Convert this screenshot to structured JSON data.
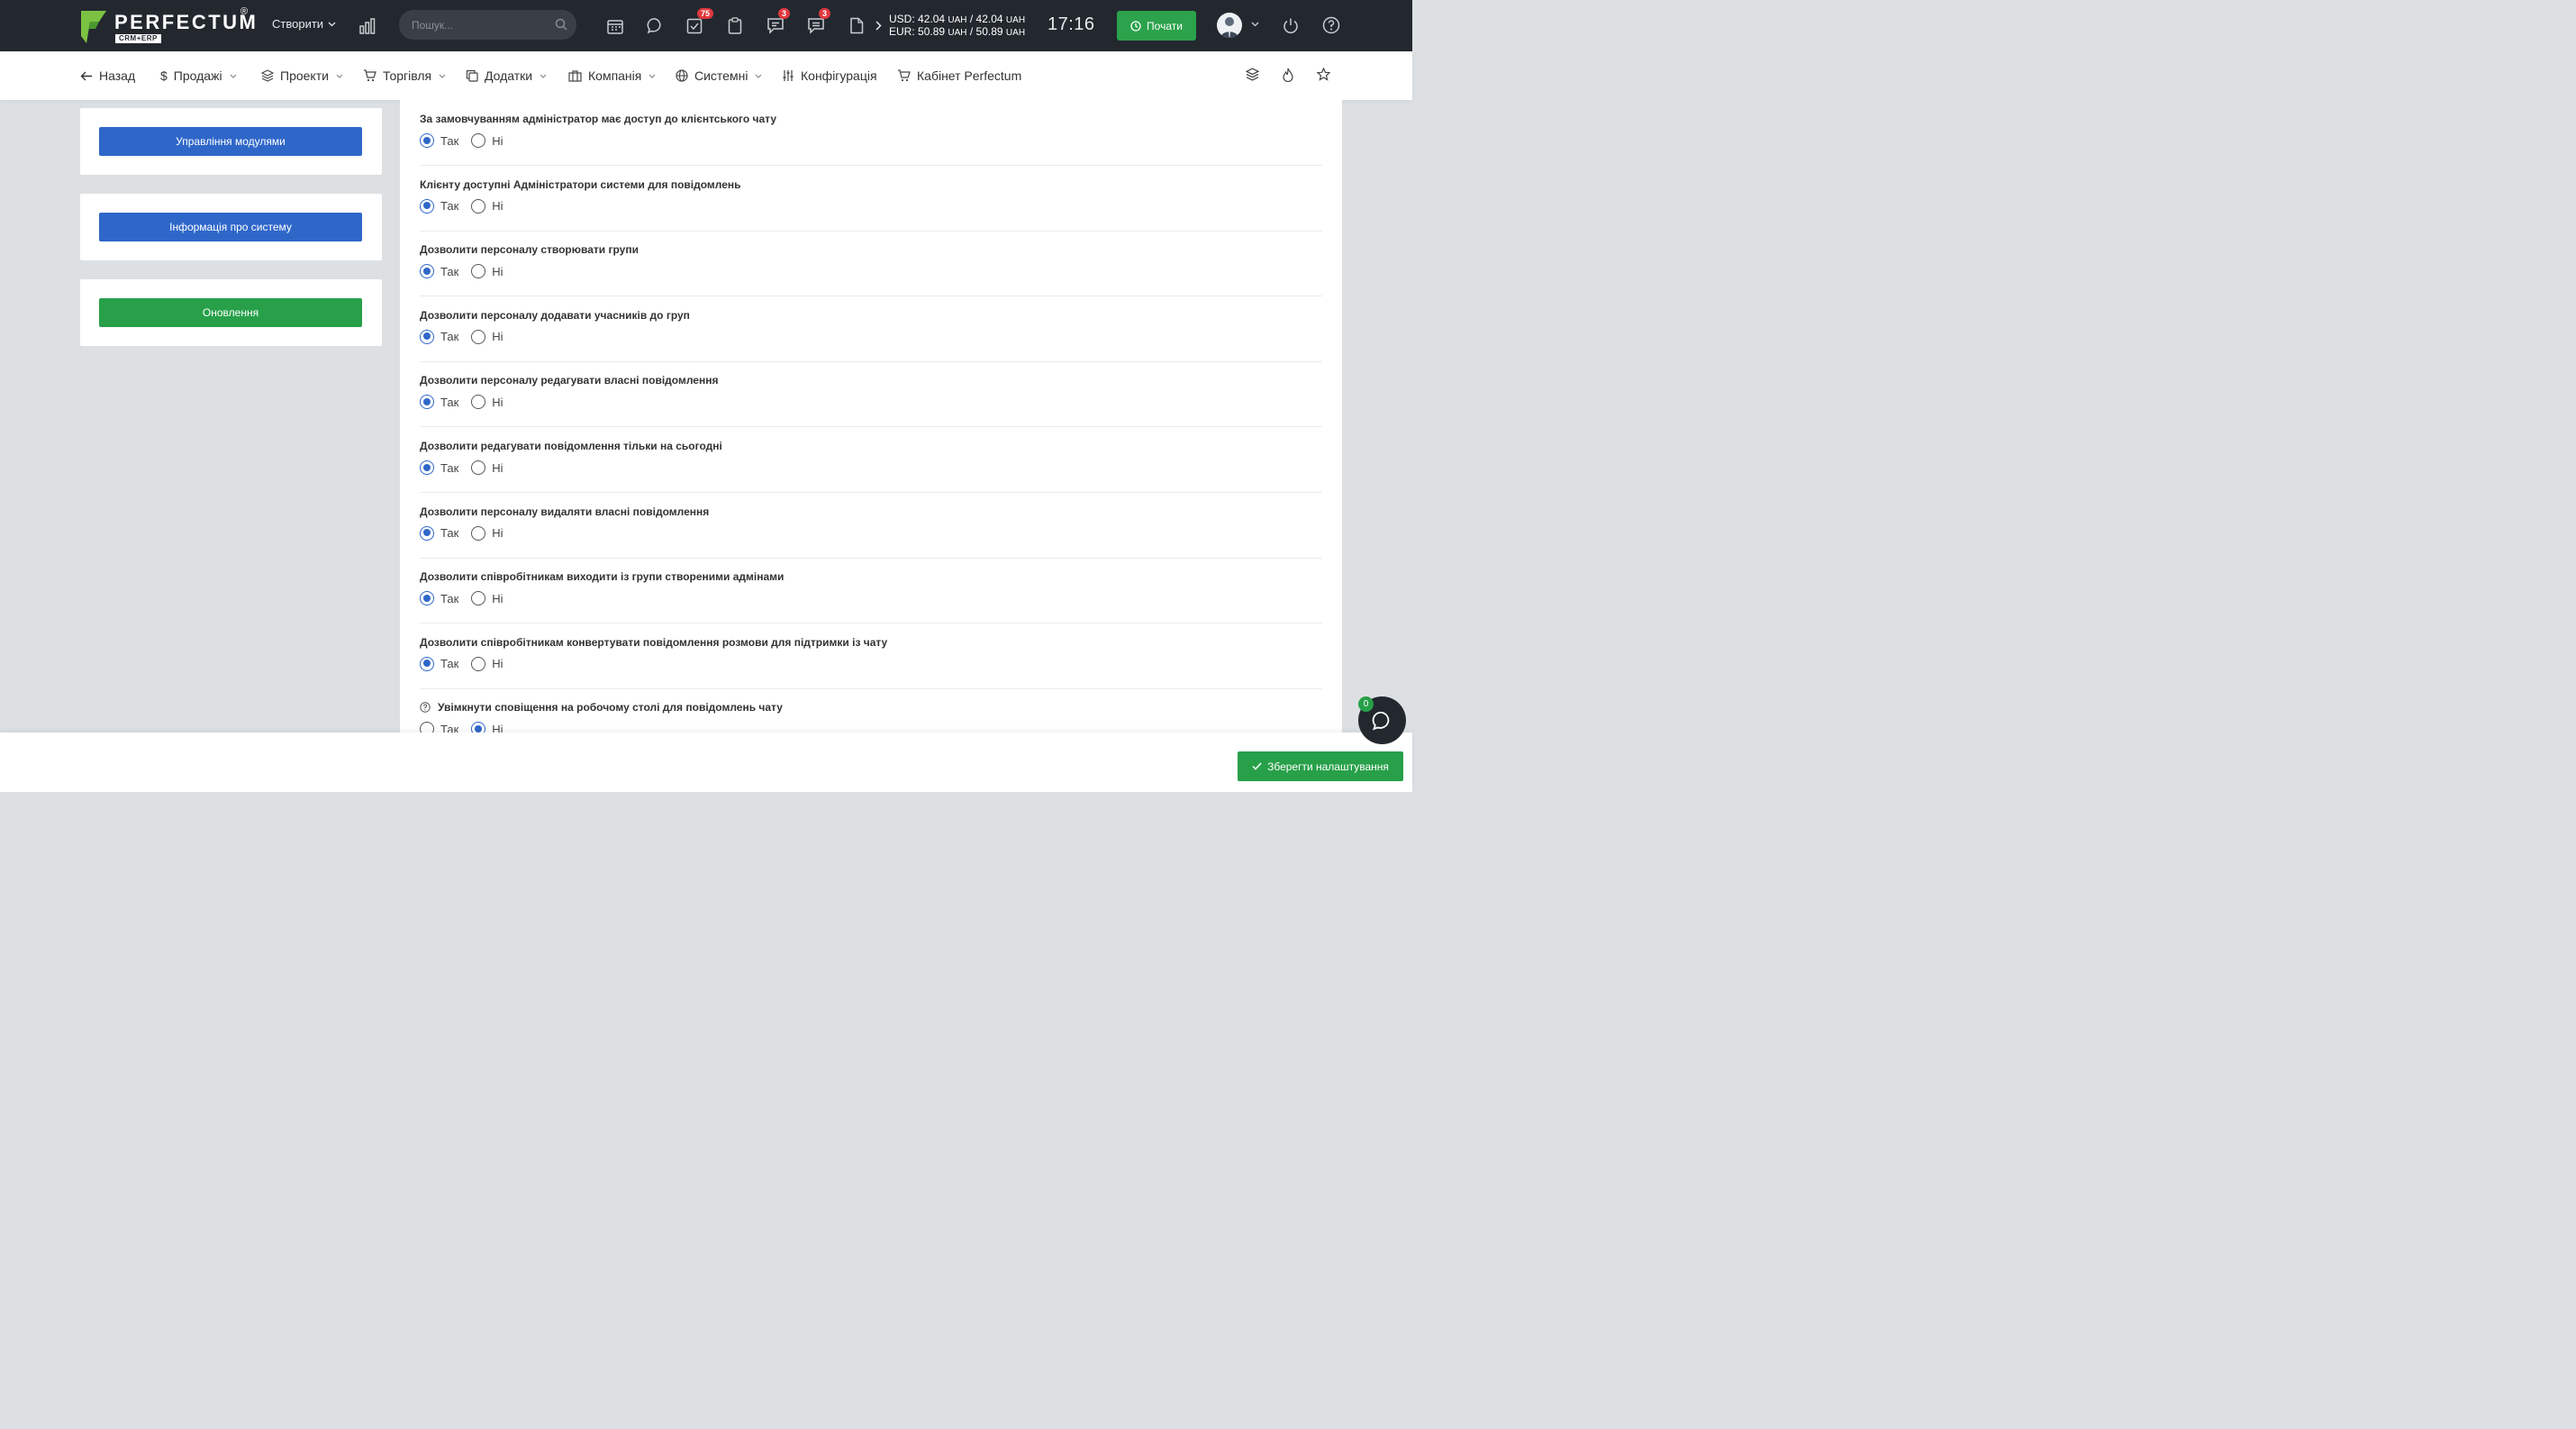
{
  "header": {
    "logo_text": "PERFECTUM",
    "logo_reg": "®",
    "logo_sub": "CRM+ERP",
    "create_label": "Створити",
    "search_placeholder": "Пошук...",
    "badges": {
      "tasks": "75",
      "chat": "3",
      "messages": "3"
    },
    "rates": {
      "usd_label": "USD:",
      "usd_value": "42.04",
      "usd_cur": "UAH",
      "usd_sep": "/",
      "usd_value2": "42.04",
      "usd_cur2": "UAH",
      "eur_label": "EUR:",
      "eur_value": "50.89",
      "eur_cur": "UAH",
      "eur_sep": "/",
      "eur_value2": "50.89",
      "eur_cur2": "UAH"
    },
    "time": "17:16",
    "start_label": "Почати"
  },
  "nav": {
    "back": "Назад",
    "sales": "Продажі",
    "projects": "Проекти",
    "trade": "Торгівля",
    "addons": "Додатки",
    "company": "Компанія",
    "system": "Системні",
    "config": "Конфігурація",
    "cabinet": "Кабінет Perfectum"
  },
  "sidebar": {
    "modules": "Управління модулями",
    "sysinfo": "Інформація про систему",
    "updates": "Оновлення"
  },
  "options": {
    "yes": "Так",
    "no": "Ні"
  },
  "settings": [
    {
      "label": "За замовчуванням адміністратор має доступ до клієнтського чату",
      "value": "yes"
    },
    {
      "label": "Клієнту доступні Адміністратори системи для повідомлень",
      "value": "yes"
    },
    {
      "label": "Дозволити персоналу створювати групи",
      "value": "yes"
    },
    {
      "label": "Дозволити персоналу додавати учасників до груп",
      "value": "yes"
    },
    {
      "label": "Дозволити персоналу редагувати власні повідомлення",
      "value": "yes"
    },
    {
      "label": "Дозволити редагувати повідомлення тільки на сьогодні",
      "value": "yes"
    },
    {
      "label": "Дозволити персоналу видаляти власні повідомлення",
      "value": "yes"
    },
    {
      "label": "Дозволити співробітникам виходити із групи створеними адмінами",
      "value": "yes"
    },
    {
      "label": "Дозволити співробітникам конвертувати повідомлення розмови для підтримки із чату",
      "value": "yes"
    },
    {
      "label": "Увімкнути сповіщення на робочому столі для повідомлень чату",
      "value": "no"
    }
  ],
  "footer": {
    "save_label": "Зберегти налаштування",
    "chat_count": "0"
  },
  "colors": {
    "accent_blue": "#2f67c9",
    "accent_green": "#27a049",
    "topbar": "#23282f",
    "badge_red": "#e0383e"
  }
}
